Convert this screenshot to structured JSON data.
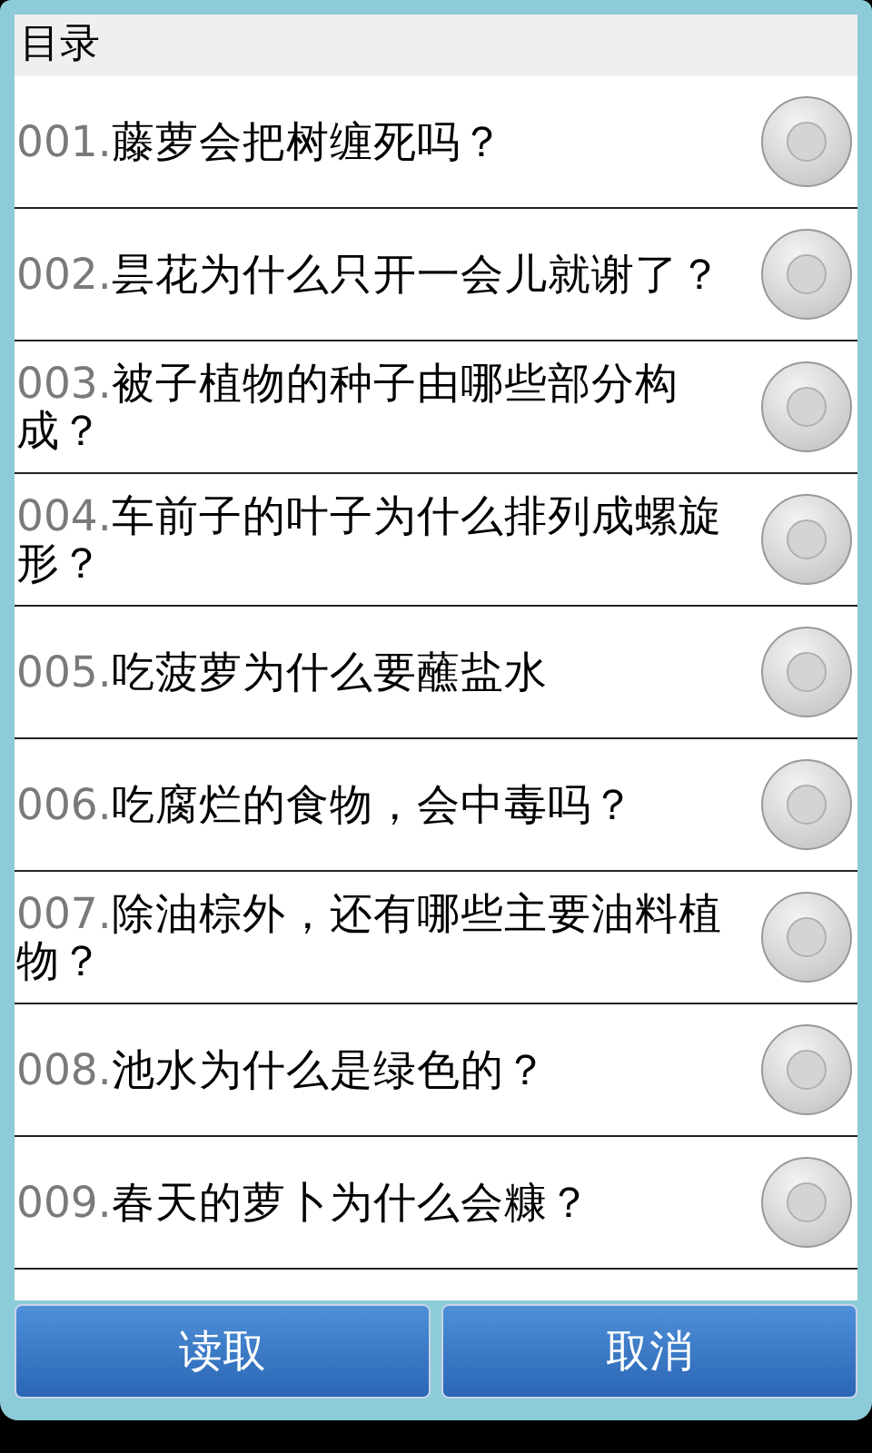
{
  "dialog": {
    "title": "目录",
    "items": [
      {
        "number": "001.",
        "text": "藤萝会把树缠死吗？",
        "selected": false
      },
      {
        "number": "002.",
        "text": "昙花为什么只开一会儿就谢了？",
        "selected": false
      },
      {
        "number": "003.",
        "text": "被子植物的种子由哪些部分构成？",
        "selected": false
      },
      {
        "number": "004.",
        "text": "车前子的叶子为什么排列成螺旋形？",
        "selected": false
      },
      {
        "number": "005.",
        "text": "吃菠萝为什么要蘸盐水",
        "selected": false
      },
      {
        "number": "006.",
        "text": "吃腐烂的食物，会中毒吗？",
        "selected": false
      },
      {
        "number": "007.",
        "text": "除油棕外，还有哪些主要油料植物？",
        "selected": false
      },
      {
        "number": "008.",
        "text": "池水为什么是绿色的？",
        "selected": false
      },
      {
        "number": "009.",
        "text": "春天的萝卜为什么会糠？",
        "selected": false
      }
    ],
    "buttons": [
      "读取",
      "取消"
    ]
  }
}
